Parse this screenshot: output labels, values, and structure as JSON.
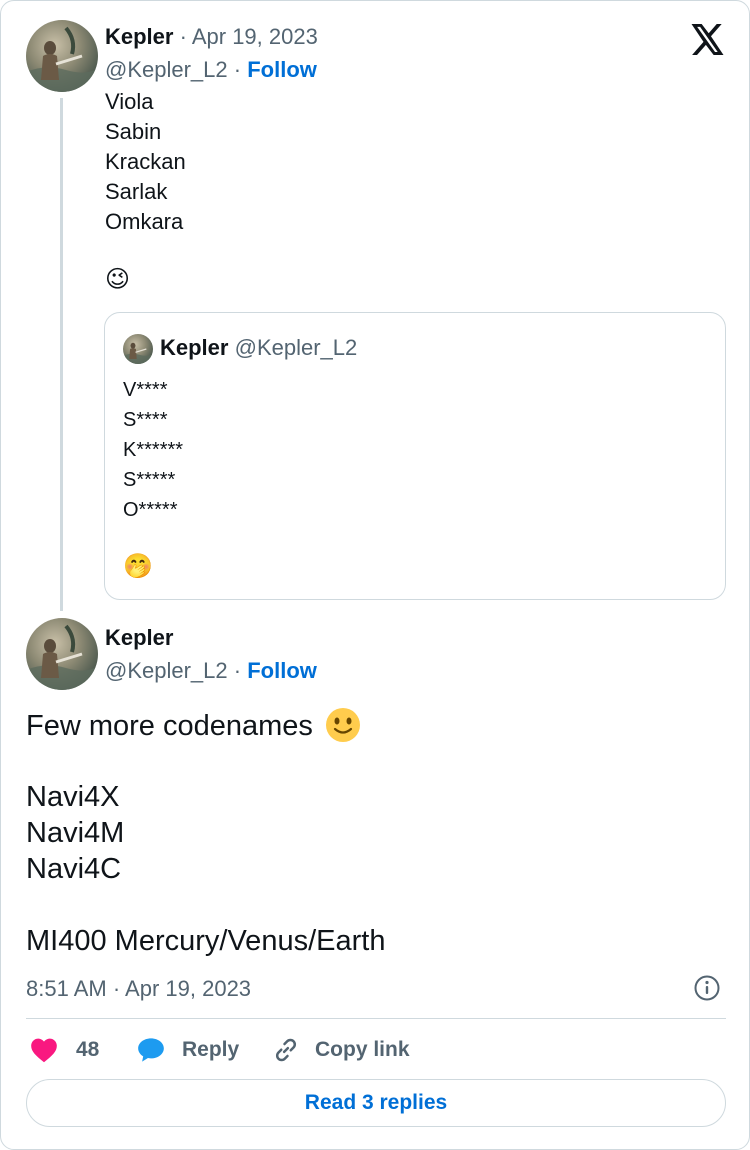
{
  "parent_tweet": {
    "author_name": "Kepler",
    "date": "Apr 19, 2023",
    "separator": "·",
    "handle": "@Kepler_L2",
    "follow_label": "Follow",
    "lines": [
      "Viola",
      "Sabin",
      "Krackan",
      "Sarlak",
      "Omkara"
    ],
    "emoji": "😉",
    "quoted": {
      "author_name": "Kepler",
      "handle": "@Kepler_L2",
      "lines": [
        "V****",
        "S****",
        "K******",
        "S*****",
        "O*****"
      ],
      "emoji": "🤭"
    }
  },
  "main_tweet": {
    "author_name": "Kepler",
    "handle": "@Kepler_L2",
    "separator": "·",
    "follow_label": "Follow",
    "text_first_line": "Few more codenames",
    "text_lines": [
      "Navi4X",
      "Navi4M",
      "Navi4C"
    ],
    "text_last_line": "MI400 Mercury/Venus/Earth",
    "timestamp": "8:51 AM · Apr 19, 2023"
  },
  "actions": {
    "like_count": "48",
    "reply_label": "Reply",
    "copy_link_label": "Copy link",
    "read_replies_label": "Read 3 replies"
  },
  "colors": {
    "accent": "#006fd6",
    "like": "#f91880",
    "reply_icon": "#1d9bf0",
    "muted": "#536471",
    "border": "#cfd9de"
  },
  "icons": {
    "brand": "x-logo-icon",
    "info": "info-icon",
    "like": "heart-icon",
    "reply": "speech-bubble-icon",
    "copy": "link-icon",
    "emoji": "smiling-face-icon"
  }
}
